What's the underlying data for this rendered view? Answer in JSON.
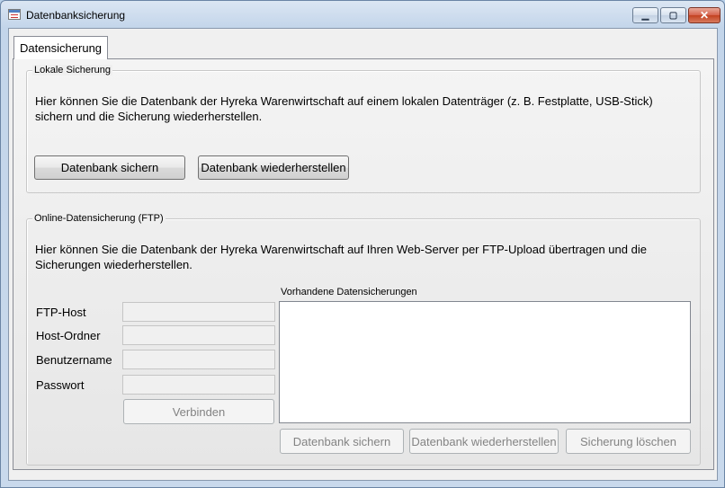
{
  "window": {
    "title": "Datenbanksicherung",
    "minimize": "▁",
    "maximize": "▢",
    "close": "✕"
  },
  "tabs": [
    {
      "label": "Datensicherung",
      "active": true
    }
  ],
  "local_backup": {
    "legend": "Lokale Sicherung",
    "description_line1": "Hier können Sie die Datenbank der Hyreka Warenwirtschaft auf einem lokalen Datenträger (z. B. Festplatte, USB-Stick)",
    "description_line2": "sichern und die Sicherung wiederherstellen.",
    "save_button": "Datenbank sichern",
    "restore_button": "Datenbank wiederherstellen"
  },
  "online_backup": {
    "legend": "Online-Datensicherung (FTP)",
    "description_line1": "Hier können Sie die Datenbank der Hyreka Warenwirtschaft auf Ihren Web-Server per FTP-Upload übertragen und die",
    "description_line2": "Sicherungen wiederherstellen.",
    "fields": {
      "host_label": "FTP-Host",
      "host_value": "",
      "folder_label": "Host-Ordner",
      "folder_value": "",
      "user_label": "Benutzername",
      "user_value": "",
      "password_label": "Passwort",
      "password_value": ""
    },
    "connect_button": "Verbinden",
    "list_label": "Vorhandene Datensicherungen",
    "list_items": [],
    "save_button": "Datenbank sichern",
    "restore_button": "Datenbank wiederherstellen",
    "delete_button": "Sicherung löschen"
  }
}
